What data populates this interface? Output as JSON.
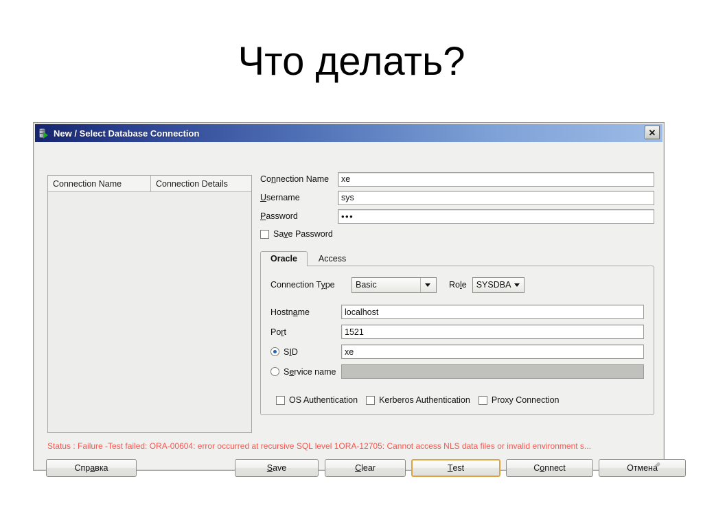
{
  "slide": {
    "title": "Что делать?"
  },
  "dialog": {
    "title": "New / Select Database Connection",
    "titlebar_icon": "database-connection-icon",
    "close_label": "✕",
    "connection_list": {
      "columns": [
        "Connection Name",
        "Connection Details"
      ],
      "rows": []
    },
    "fields": {
      "connection_name": {
        "label_pre": "Co",
        "label_mnemonic": "n",
        "label_post": "nection Name",
        "value": "xe"
      },
      "username": {
        "label_pre": "",
        "label_mnemonic": "U",
        "label_post": "sername",
        "value": "sys"
      },
      "password": {
        "label_pre": "",
        "label_mnemonic": "P",
        "label_post": "assword",
        "value": "•••"
      },
      "save_password": {
        "label_pre": "Sa",
        "label_mnemonic": "v",
        "label_post": "e Password",
        "checked": false
      }
    },
    "tabs": [
      {
        "label": "Oracle",
        "active": true
      },
      {
        "label": "Access",
        "active": false
      }
    ],
    "oracle_tab": {
      "connection_type": {
        "label_pre": "Connection T",
        "label_mnemonic": "y",
        "label_post": "pe",
        "value": "Basic"
      },
      "role": {
        "label_pre": "Ro",
        "label_mnemonic": "l",
        "label_post": "e",
        "value": "SYSDBA"
      },
      "hostname": {
        "label_pre": "Hostn",
        "label_mnemonic": "a",
        "label_post": "me",
        "value": "localhost"
      },
      "port": {
        "label_pre": "Po",
        "label_mnemonic": "r",
        "label_post": "t",
        "value": "1521"
      },
      "sid": {
        "label_pre": "S",
        "label_mnemonic": "I",
        "label_post": "D",
        "selected": true,
        "value": "xe"
      },
      "service_name": {
        "label_pre": "S",
        "label_mnemonic": "e",
        "label_post": "rvice name",
        "selected": false,
        "value": "",
        "disabled": true
      },
      "checkboxes": [
        {
          "label": "OS Authentication",
          "checked": false
        },
        {
          "label": "Kerberos Authentication",
          "checked": false
        },
        {
          "label": "Proxy Connection",
          "checked": false
        }
      ]
    },
    "status": "Status : Failure -Test failed: ORA-00604: error occurred at recursive SQL level 1ORA-12705: Cannot access NLS data files or invalid environment s...",
    "status_color": "#f4574f",
    "buttons": [
      {
        "name": "help",
        "label_pre": "Спр",
        "label_mnemonic": "а",
        "label_post": "вка",
        "focused": false
      },
      {
        "name": "save",
        "label_pre": "",
        "label_mnemonic": "S",
        "label_post": "ave",
        "focused": false
      },
      {
        "name": "clear",
        "label_pre": "",
        "label_mnemonic": "C",
        "label_post": "lear",
        "focused": false
      },
      {
        "name": "test",
        "label_pre": "",
        "label_mnemonic": "T",
        "label_post": "est",
        "focused": true
      },
      {
        "name": "connect",
        "label_pre": "C",
        "label_mnemonic": "o",
        "label_post": "nnect",
        "focused": false
      },
      {
        "name": "cancel",
        "label_pre": "Отмена",
        "label_mnemonic": "",
        "label_post": "",
        "focused": false
      }
    ]
  }
}
